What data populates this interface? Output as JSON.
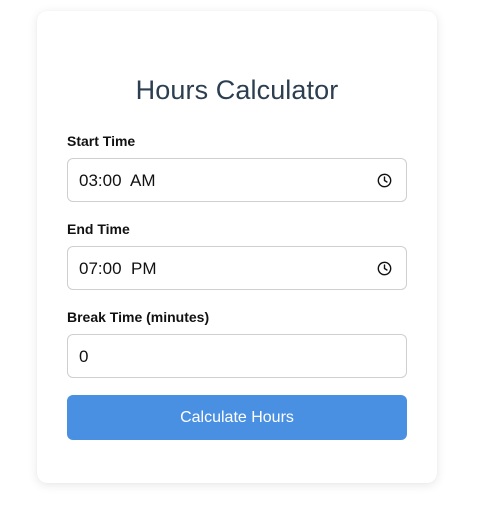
{
  "calculator": {
    "title": "Hours Calculator",
    "start_time": {
      "label": "Start Time",
      "value": "03:00  AM",
      "icon": "clock-icon"
    },
    "end_time": {
      "label": "End Time",
      "value": "07:00  PM",
      "icon": "clock-icon"
    },
    "break_time": {
      "label": "Break Time (minutes)",
      "value": "0"
    },
    "calculate_button_label": "Calculate Hours"
  },
  "colors": {
    "title": "#2c3e50",
    "button": "#4a90e2",
    "input_border": "#cfcfcf"
  }
}
